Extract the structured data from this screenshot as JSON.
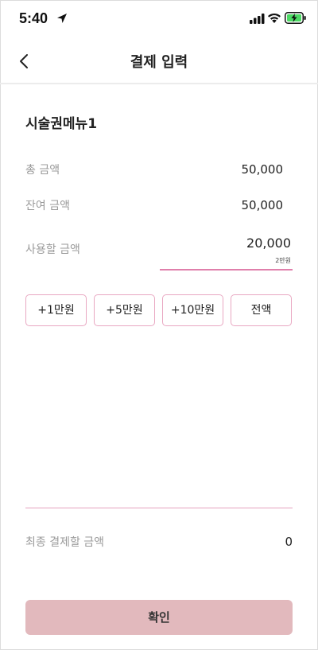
{
  "status_bar": {
    "time": "5:40",
    "icons": [
      "location-arrow-icon",
      "cellular-signal-icon",
      "wifi-icon",
      "battery-charging-icon"
    ]
  },
  "nav": {
    "title": "결제 입력",
    "back_icon": "chevron-left-icon"
  },
  "menu_name": "시술권메뉴1",
  "rows": {
    "total": {
      "label": "총 금액",
      "value": "50,000"
    },
    "remaining": {
      "label": "잔여 금액",
      "value": "50,000"
    },
    "use": {
      "label": "사용할 금액",
      "value": "20,000",
      "hint": "2만원"
    }
  },
  "quick_buttons": [
    "+1만원",
    "+5만원",
    "+10만원",
    "전액"
  ],
  "final": {
    "label": "최종 결제할 금액",
    "value": "0"
  },
  "confirm_label": "확인",
  "colors": {
    "accent_pink": "#e07fab",
    "button_border": "#e9a8c2",
    "confirm_bg": "#e2b9bd",
    "battery_green": "#4cd964"
  }
}
